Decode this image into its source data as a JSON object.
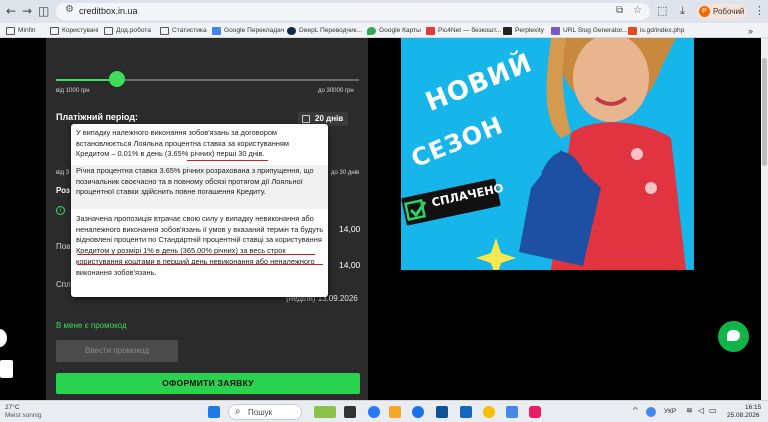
{
  "browser": {
    "url": "creditbox.in.ua",
    "profile_label": "Робочий",
    "profile_initial": "Р",
    "bookmarks": [
      "Minfin",
      "Користувачі",
      "Дод.робота",
      "Статистика",
      "Google Перекладач",
      "DeepL Переводчик...",
      "Google Карты",
      "Pic4Net — безкошт...",
      "Perplexity",
      "URL Slug Generator...",
      "is.gd/index.php"
    ],
    "bookmarks_more": "»"
  },
  "calculator": {
    "amount_min": "від 1000 грн",
    "amount_max": "до 30000 грн",
    "amount_slider_fraction": 0.2,
    "period_label": "Платіжний період:",
    "period_value": "20 днів",
    "period_min": "від 3",
    "period_max": "до 30 днів",
    "row_label_1": "Роз",
    "info_glyph": "i",
    "row_label_2": "Пов",
    "row_label_3": "Спл",
    "value_1": "14,00",
    "value_2": "14,00",
    "due_date": "(неділя) 13.09.2026",
    "promo_label": "В мене є промокод",
    "promo_button": "Ввести промокод",
    "apply_button": "ОФОРМИТИ ЗАЯВКУ"
  },
  "tooltip": {
    "p1": "У випадку належного виконання зобов'язань за договором встановлюється Лояльна процентна ставка за користуванням Кредитом – 0.01% в день (3.65% річних) перші 30 днів.",
    "p2": "Річна процентна ставка 3.65% річних розрахована з припущення, що позичальник своєчасно та в повному обсязі протягом дії Лояльної процентної ставки здійснить повне погашення Кредиту.",
    "p3": "Зазначена пропозиція втрачає свою силу у випадку невиконання або неналежного виконання зобов'язань ії умов у вказаний термін та будуть відновлені проценти по Стандартній процентній ставці за користування Кредитом у розмірі 1% в день (365.00% річних) за весь строк користування коштами в перший день невиконання або неналежного виконання зобов'язань."
  },
  "banner": {
    "line1": "НОВИЙ",
    "line2": "СЕЗОН",
    "badge": "СПЛАЧЕНО"
  },
  "taskbar": {
    "weather_temp": "27°C",
    "weather_desc": "Meist sonnig",
    "search_label": "Пошук",
    "lang": "УКР",
    "time": "16:15",
    "date": "25.08.2026"
  }
}
